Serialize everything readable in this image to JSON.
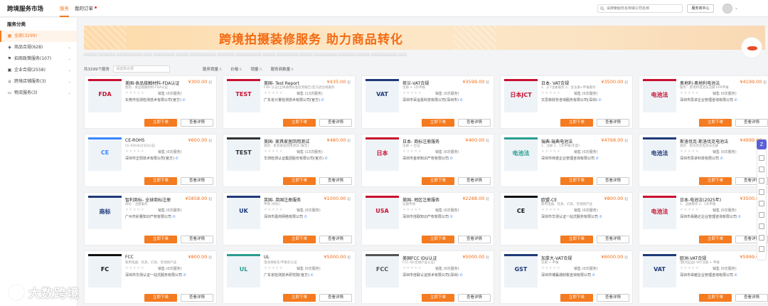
{
  "header": {
    "brand": "跨境服务市场",
    "tabs": [
      {
        "label": "服务",
        "active": true
      },
      {
        "label": "我的订单",
        "badge": true
      }
    ],
    "search_placeholder": "请搜索服务名称或公司名称",
    "service_center": "服务商中心"
  },
  "sidebar": {
    "title": "服务分类",
    "items": [
      {
        "label": "全部(3299)",
        "icon": "grid-icon",
        "active": true,
        "expandable": false
      },
      {
        "label": "商品合规(628)",
        "icon": "shield-icon",
        "active": false,
        "expandable": true
      },
      {
        "label": "招商政策服务(107)",
        "icon": "flag-icon",
        "active": false,
        "expandable": true
      },
      {
        "label": "企业合规(2558)",
        "icon": "building-icon",
        "active": false,
        "expandable": true
      },
      {
        "label": "跨境店铺服务(3)",
        "icon": "store-icon",
        "active": false,
        "expandable": true
      },
      {
        "label": "物流服务(3)",
        "icon": "truck-icon",
        "active": false,
        "expandable": true
      }
    ]
  },
  "banner": {
    "text": "跨境拍摄装修服务 助力商品转化"
  },
  "filter": {
    "total": "共3299个服务",
    "select_placeholder": "请选择合规",
    "sorts": [
      "服务销量",
      "价格",
      "销量",
      "服务商数量"
    ]
  },
  "cards": [
    {
      "title": "美国-食品接触材料-FDA认证",
      "price": "¥300.00",
      "unit": "起",
      "subtitle": "类别 - 食品接触材料-FDA认证",
      "sales": "销售 (0次服务)",
      "company": "东莞市信测检测技术有限公司(官方)",
      "thumb": "FDA",
      "color": "#c8102e"
    },
    {
      "title": "美国- Test Report",
      "price": "¥435.00",
      "unit": "起",
      "subtitle": "FDA 认证(全球通用标准检测报告)亚马逊合规服务",
      "sales": "销售 (13次服务)",
      "company": "广东省计量检测技术有限公司(官方)",
      "thumb": "TEST",
      "color": "#c8102e"
    },
    {
      "title": "荷兰-VAT合规",
      "price": "¥3599.00",
      "unit": "起",
      "subtitle": "注册 + 1年申报",
      "sales": "销售 (0次服务)",
      "company": "深圳市百运嘉科技有限公司(深圳市)",
      "thumb": "VAT",
      "color": "#1f3a78"
    },
    {
      "title": "日本- VAT合规",
      "price": "¥3500.00",
      "unit": "起",
      "subtitle": "1、JCT注册服务 2、含注册+申报服务",
      "sales": "销售 (0次服务)",
      "company": "文思菲财务咨询服务有限公司(深圳)",
      "thumb": "日本JCT",
      "color": "#c8102e"
    },
    {
      "title": "奥地利-奥地利电池法",
      "price": "¥4199.00",
      "unit": "起",
      "subtitle": "服务 - 奥地利电池法注册 EPR申报",
      "sales": "销售 (0次服务)",
      "company": "深圳市思卓企业管理咨询有限公司",
      "thumb": "电池法",
      "color": "#c8102e"
    },
    {
      "title": "CE-ROHS",
      "price": "¥600.00",
      "unit": "起",
      "subtitle": "CE-ROHS(Z3Q认证)",
      "sales": "销售 (0次服务)",
      "company": "深圳市正阳技术有限公司(官方)",
      "thumb": "CE",
      "color": "#3a86ff"
    },
    {
      "title": "美国- 家具家居回用测试",
      "price": "¥480.00",
      "unit": "起",
      "subtitle": "类别 - 家具家居回用测试 (报告)",
      "sales": "销售 (13次服务)",
      "company": "华测检测认证集团股份有限公司(官方)",
      "thumb": "TEST",
      "color": "#333"
    },
    {
      "title": "日本- 商标注册服务",
      "price": "¥400.00",
      "unit": "起",
      "subtitle": "注册 + 出证",
      "sales": "销售 (0次服务)",
      "company": "深圳市金桥知识产权有限公司",
      "thumb": "日本",
      "color": "#c8102e"
    },
    {
      "title": "瑞典-瑞典电池法",
      "price": "¥4768.00",
      "unit": "起",
      "subtitle": "1、注册 2、1年申报(年度)",
      "sales": "销售 (0次服务)",
      "company": "深圳市缔诺企业管理咨询有限公司",
      "thumb": "电池法",
      "color": "#2a9d8f"
    },
    {
      "title": "斯洛伐克-斯洛伐克电池法",
      "price": "¥4999.00",
      "unit": "起",
      "subtitle": "类别 - 斯洛伐克电池法注册",
      "sales": "销售 (0次服务)",
      "company": "深圳市思卓科技有限公司",
      "thumb": "电池法",
      "color": "#1f3a78"
    },
    {
      "title": "智利商标- 全球商标注册",
      "price": "¥5858.00",
      "unit": "起",
      "subtitle": "商标 - 注册服务",
      "sales": "销售 (0次服务)",
      "company": "广州市彩量知识产权有限公司",
      "thumb": "商标",
      "color": "#1f3a78"
    },
    {
      "title": "英国- 英国注册服务",
      "price": "¥1000.00",
      "unit": "起",
      "subtitle": "申请 (商标)",
      "sales": "销售 (0次服务)",
      "company": "深圳市嘉商网络有限公司",
      "thumb": "UK",
      "color": "#1f3a78"
    },
    {
      "title": "美国- 地区注册服务",
      "price": "¥2288.00",
      "unit": "起",
      "subtitle": "注册申请",
      "sales": "销售 (0次服务)",
      "company": "深圳市佳联知识产权有限公司",
      "thumb": "USA",
      "color": "#c8102e"
    },
    {
      "title": "欧盟-CE",
      "price": "¥800.00",
      "unit": "起",
      "subtitle": "家用电器、玩具、灯具、音视频产品",
      "sales": "销售 (0次服务)",
      "company": "深圳市华测认证一站式服务有限公司",
      "thumb": "CE",
      "color": "#111"
    },
    {
      "title": "日本-电池法(2025年)",
      "price": "¥3500.00",
      "unit": "起",
      "subtitle": "1、注册服务 2、1年申报",
      "sales": "销售 (0次服务)",
      "company": "深圳市易路达企业管理咨询有限公司",
      "thumb": "电池法",
      "color": "#c8102e"
    },
    {
      "title": "FCC",
      "price": "¥800.00",
      "unit": "起",
      "subtitle": "家用电器、玩具、灯具、音视频产品",
      "sales": "销售 (0次服务)",
      "company": "深圳市华测认证一站式服务有限公司",
      "thumb": "FC",
      "color": "#111"
    },
    {
      "title": "UL",
      "price": "¥5000.00",
      "unit": "起",
      "subtitle": "电动滑板车/平衡车认证",
      "sales": "销售 (0次服务)",
      "company": "广东省检测技术研究院(官方)",
      "thumb": "UL",
      "color": "#2a9d8f"
    },
    {
      "title": "美国FCC IDU认证",
      "price": "¥5000.00",
      "unit": "起",
      "subtitle": "FCC-ID(无线产品认证)",
      "sales": "销售 (0次服务)",
      "company": "深圳市佳联认证技术有限公司(深圳)",
      "thumb": "FCC",
      "color": "#555"
    },
    {
      "title": "加拿大-VAT合规",
      "price": "¥6000.00",
      "unit": "起",
      "subtitle": "注册 + 申报",
      "sales": "销售 (0次服务)",
      "company": "深圳市博赢通财税咨询有限公司",
      "thumb": "GST",
      "color": "#1f3a78"
    },
    {
      "title": "欧洲-VAT合规",
      "price": "¥5999.00",
      "unit": "起",
      "subtitle": "(欧洲五国) VAT注册 + 申报",
      "sales": "销售 (0次服务)",
      "company": "深圳市卓越企业管理咨询有限公司",
      "thumb": "VAT",
      "color": "#1f3a78"
    }
  ],
  "card_buttons": {
    "order": "立即下单",
    "detail": "查看详情"
  },
  "watermark": {
    "text": "大数跨境"
  }
}
